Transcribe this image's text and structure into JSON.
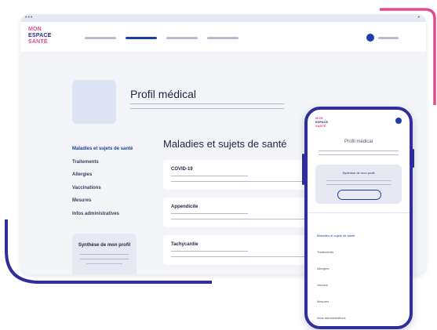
{
  "brand": {
    "logo_line1": "MON",
    "logo_line2": "ESPACE",
    "logo_line3": "SANTÉ",
    "colors": {
      "primary": "#1b3fa3",
      "accent": "#e24a8f",
      "frame": "#2e2f9c",
      "background": "#f2f4f8"
    }
  },
  "window": {
    "controls_left": "•••",
    "controls_right": "•"
  },
  "profile": {
    "title": "Profil médical"
  },
  "sidebar": {
    "items": [
      {
        "label": "Maladies et sujets de santé"
      },
      {
        "label": "Traitements"
      },
      {
        "label": "Allergies"
      },
      {
        "label": "Vaccinations"
      },
      {
        "label": "Mesures"
      },
      {
        "label": "Infos administratives"
      }
    ],
    "summary_title": "Synthèse de mon profil"
  },
  "section": {
    "title": "Maladies et sujets de santé",
    "cards": [
      {
        "label": "COVID-19"
      },
      {
        "label": "Appendicite"
      },
      {
        "label": "Tachycardie"
      }
    ]
  },
  "mobile": {
    "title": "Profil médical",
    "summary_title": "Synthèse de mon profil",
    "nav": [
      {
        "label": "Maladies et sujets de santé"
      },
      {
        "label": "Traitements"
      },
      {
        "label": "Allergies"
      },
      {
        "label": "Vaccins"
      },
      {
        "label": "Mesures"
      },
      {
        "label": "Infos administratives"
      }
    ]
  }
}
